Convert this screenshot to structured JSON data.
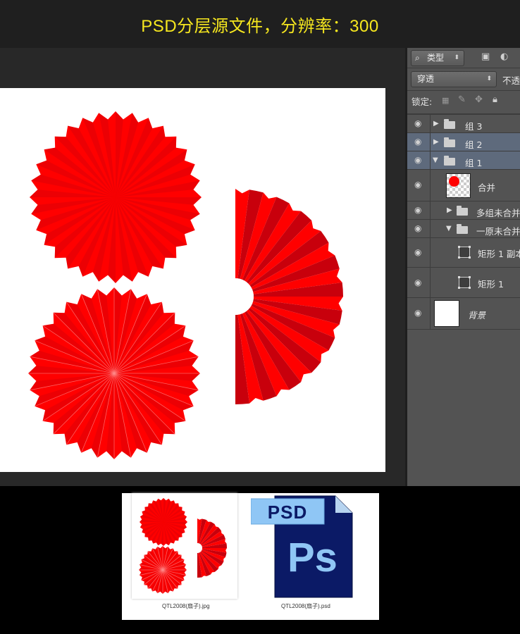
{
  "banner": {
    "title": "PSD分层源文件，分辨率：300"
  },
  "layers_panel": {
    "filter_type_label": "类型",
    "blend_mode": "穿透",
    "opacity_label": "不透",
    "lock_label": "锁定:",
    "layers": [
      {
        "name": "组 3",
        "kind": "group",
        "expanded": false,
        "selected": false
      },
      {
        "name": "组 2",
        "kind": "group",
        "expanded": false,
        "selected": true
      },
      {
        "name": "组 1",
        "kind": "group",
        "expanded": true,
        "selected": true
      },
      {
        "name": "合并",
        "kind": "pixel"
      },
      {
        "name": "多组未合并",
        "kind": "group",
        "expanded": false
      },
      {
        "name": "一原未合并",
        "kind": "group",
        "expanded": true
      },
      {
        "name": "矩形 1 副本",
        "kind": "shape"
      },
      {
        "name": "矩形 1",
        "kind": "shape"
      },
      {
        "name": "背景",
        "kind": "background"
      }
    ]
  },
  "files": [
    {
      "name": "QTL2008(扇子).jpg",
      "icon": "image-thumbnail-icon"
    },
    {
      "name": "QTL2008(扇子).psd",
      "icon": "photoshop-file-icon",
      "badge": "PSD",
      "logo": "Ps"
    }
  ],
  "colors": {
    "fan_red": "#ff0000",
    "fan_dark": "#c8000c",
    "banner_text": "#f6e71f",
    "ps_blue": "#0b1a66",
    "psd_badge": "#8fc6f5"
  }
}
